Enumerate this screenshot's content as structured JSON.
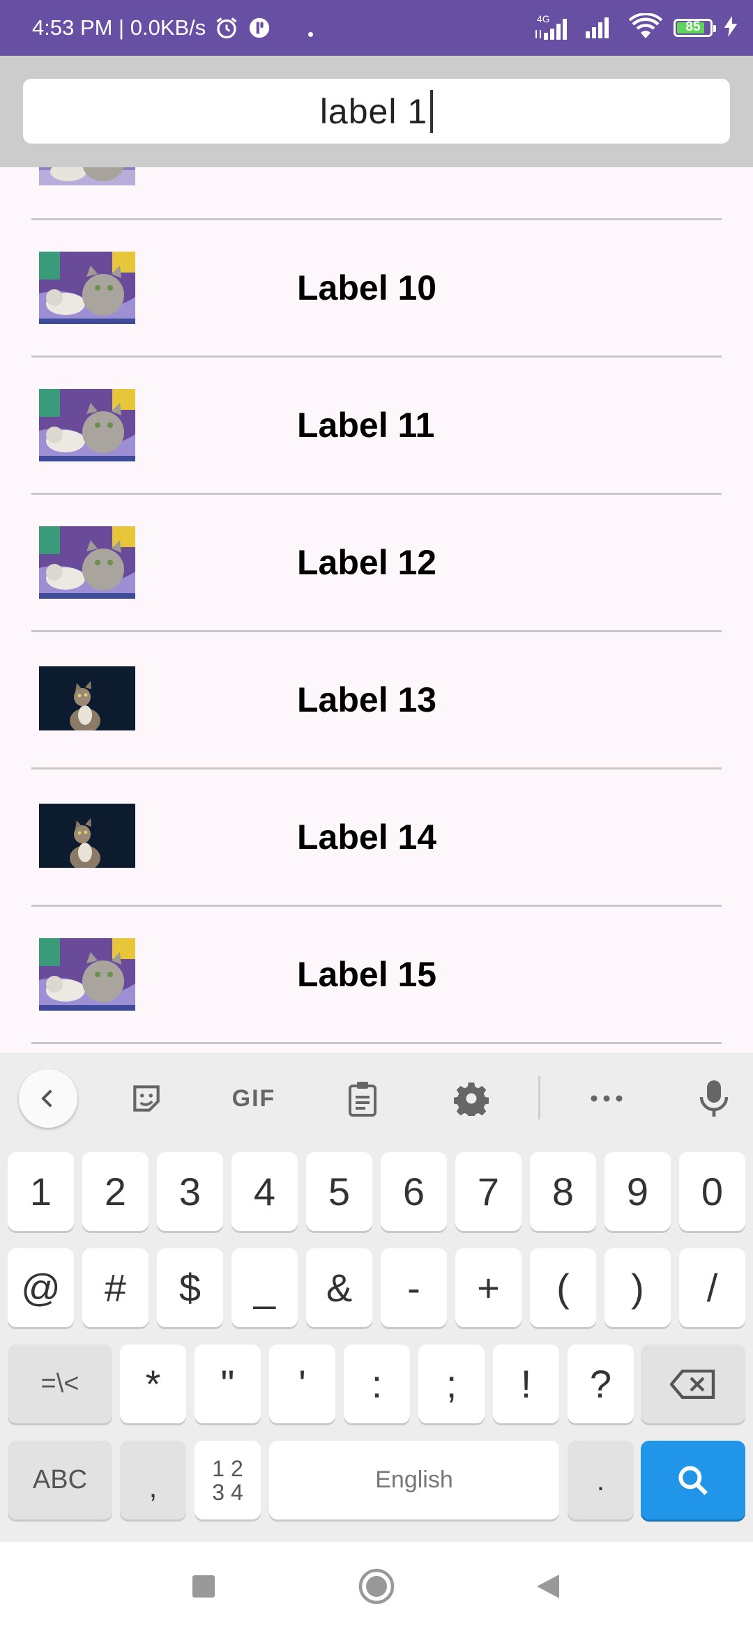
{
  "status_bar": {
    "time_speed": "4:53 PM | 0.0KB/s",
    "network": "4G",
    "battery": "85",
    "battery_level_percent": 85
  },
  "search": {
    "value": "label 1",
    "placeholder": ""
  },
  "list": {
    "items": [
      {
        "label": "Label 10",
        "image": "kittens-on-purple-blanket"
      },
      {
        "label": "Label 11",
        "image": "kittens-on-purple-blanket"
      },
      {
        "label": "Label 12",
        "image": "kittens-on-purple-blanket"
      },
      {
        "label": "Label 13",
        "image": "tabby-cat-looking-up"
      },
      {
        "label": "Label 14",
        "image": "tabby-cat-looking-up"
      },
      {
        "label": "Label 15",
        "image": "kittens-on-purple-blanket"
      }
    ]
  },
  "keyboard": {
    "toolbar": {
      "gif_label": "GIF"
    },
    "row1": [
      "1",
      "2",
      "3",
      "4",
      "5",
      "6",
      "7",
      "8",
      "9",
      "0"
    ],
    "row2": [
      "@",
      "#",
      "$",
      "_",
      "&",
      "-",
      "+",
      "(",
      ")",
      "/"
    ],
    "row3": {
      "symbols_toggle": "=\\<",
      "keys": [
        "*",
        "\"",
        "'",
        ":",
        ";",
        "!",
        "?"
      ]
    },
    "row4": {
      "abc": "ABC",
      "comma": ",",
      "numpad_top": "1 2",
      "numpad_bottom": "3 4",
      "space": "English",
      "period": "."
    }
  },
  "colors": {
    "status_bar": "#6750a4",
    "header": "#cccccc",
    "list_bg": "#fdf7fc",
    "search_key": "#2196e8"
  }
}
